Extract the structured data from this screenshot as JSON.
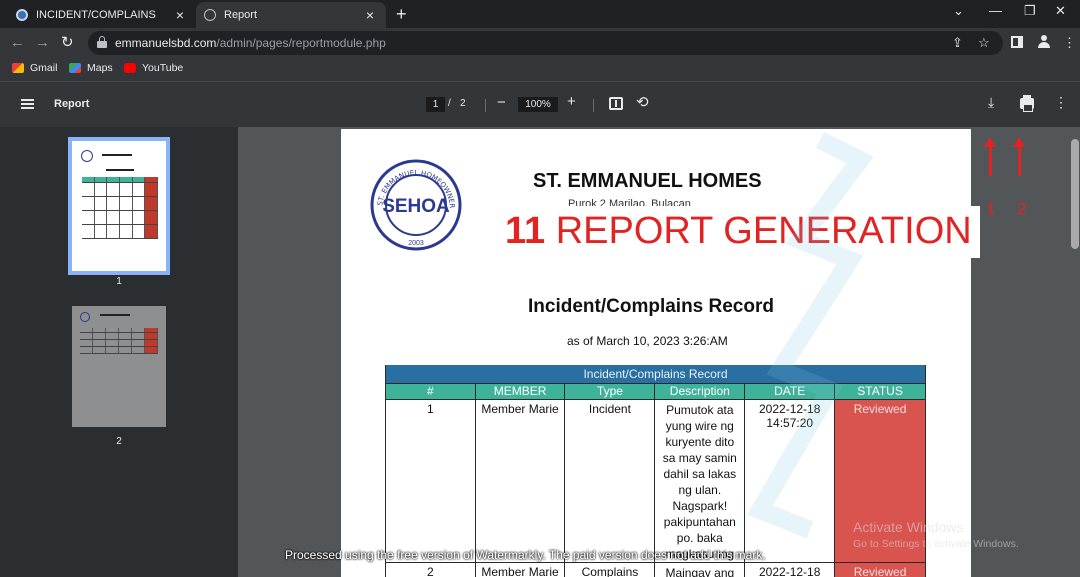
{
  "browser": {
    "tabs": [
      {
        "title": "INCIDENT/COMPLAINS"
      },
      {
        "title": "Report"
      }
    ],
    "url_host": "emmanuelsbd.com",
    "url_path": "/admin/pages/reportmodule.php",
    "bookmarks": [
      "Gmail",
      "Maps",
      "YouTube"
    ]
  },
  "viewer": {
    "title": "Report",
    "current_page": "1",
    "page_separator": "/",
    "total_pages": "2",
    "zoom": "100%",
    "thumbnails": [
      "1",
      "2"
    ]
  },
  "document": {
    "org_name": "ST. EMMANUEL HOMES",
    "address": "Purok 2 Marilao, Bulacan",
    "seal": {
      "top": "ST. EMMANUEL HOMEOWNERS' ASSOCIATION",
      "center": "SEHOA",
      "year": "2003"
    },
    "overlay": {
      "number": "11",
      "text": "REPORT GENERATION"
    },
    "title": "Incident/Complains Record",
    "as_of": "as of March 10, 2023 3:26:AM",
    "table": {
      "caption": "Incident/Complains Record",
      "headers": [
        "#",
        "MEMBER",
        "Type",
        "Description",
        "DATE",
        "STATUS"
      ],
      "rows": [
        {
          "num": "1",
          "member": "Member Marie",
          "type": "Incident",
          "description": "Pumutok ata yung wire ng kuryente dito sa may samin dahil sa lakas ng ulan. Nagspark! pakipuntahan po. baka magkasunog",
          "date": "2022-12-18 14:57:20",
          "status": "Reviewed"
        },
        {
          "num": "2",
          "member": "Member Marie",
          "type": "Complains",
          "description": "Maingay ang",
          "date": "2022-12-18",
          "status": "Reviewed"
        }
      ]
    }
  },
  "annotations": {
    "arrow_labels": [
      "1",
      "2"
    ],
    "accent": "#e02424"
  },
  "watermarks": {
    "activate_title": "Activate Windows",
    "activate_sub": "Go to Settings to activate Windows.",
    "processed": "Processed using the free version of Watermarkly. The paid version does not add this mark."
  },
  "colors": {
    "table_caption": "#2a6fa2",
    "table_header": "#3fb39a",
    "status_reviewed": "#d9534f"
  }
}
